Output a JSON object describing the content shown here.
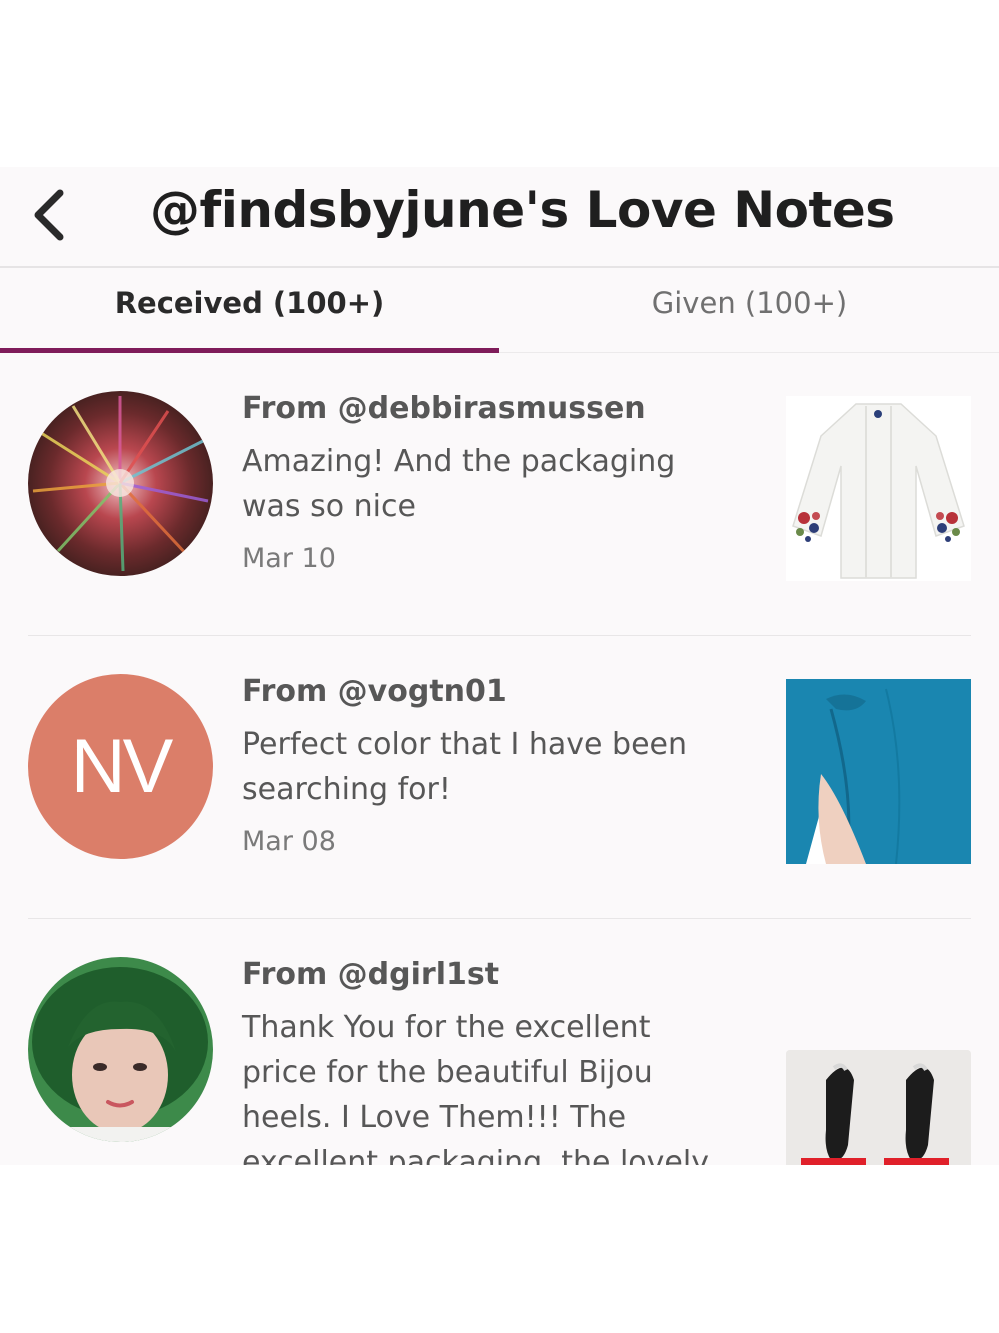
{
  "header": {
    "title": "@findsbyjune's Love Notes",
    "back_icon": "chevron-left-icon"
  },
  "tabs": [
    {
      "label": "Received (100+)",
      "active": true
    },
    {
      "label": "Given (100+)",
      "active": false
    }
  ],
  "colors": {
    "accent": "#7f1c5a",
    "avatar_initials_bg": "#db7e69"
  },
  "notes": [
    {
      "from": "From @debbirasmussen",
      "message": "Amazing! And the packaging was so nice",
      "date": "Mar 10",
      "avatar": "kaleidoscope-photo",
      "thumbnail": "white-kimono-cardigan"
    },
    {
      "from": "From @vogtn01",
      "message": "Perfect color that I have been searching for!",
      "date": "Mar 08",
      "avatar_initials": "NV",
      "thumbnail": "teal-sarong-wrap"
    },
    {
      "from": "From @dgirl1st",
      "message": "Thank You for the excellent price for the beautiful Bijou heels. I Love Them!!! The excellent packaging, the lovely",
      "avatar": "woman-portrait-photo",
      "thumbnail": "bijou-heels"
    }
  ]
}
